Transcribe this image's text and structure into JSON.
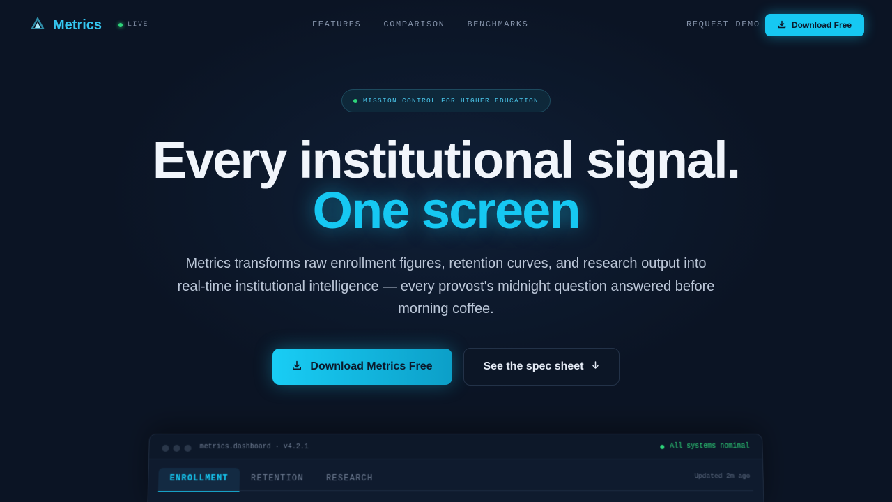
{
  "nav": {
    "logo_text": "Metrics",
    "live_label": "LIVE",
    "links": [
      "FEATURES",
      "COMPARISON",
      "BENCHMARKS"
    ],
    "request_demo": "REQUEST DEMO",
    "download_label": "Download Free"
  },
  "badge": {
    "text": "MISSION CONTROL FOR HIGHER EDUCATION"
  },
  "hero": {
    "line1": "Every institutional signal.",
    "line2": "One screen",
    "subtitle": "Metrics transforms raw enrollment figures, retention curves, and research output into real-time institutional intelligence — every provost's midnight question answered before morning coffee."
  },
  "cta": {
    "primary": "Download Metrics Free",
    "secondary": "See the spec sheet"
  },
  "dashboard": {
    "window_title": "metrics.dashboard · v4.2.1",
    "status": "All systems nominal",
    "tabs": [
      "ENROLLMENT",
      "RETENTION",
      "RESEARCH"
    ],
    "active_tab": "ENROLLMENT",
    "updated": "Updated 2m ago"
  },
  "colors": {
    "accent": "#16c8f2",
    "live_green": "#2ed47a",
    "background": "#0b1424"
  }
}
